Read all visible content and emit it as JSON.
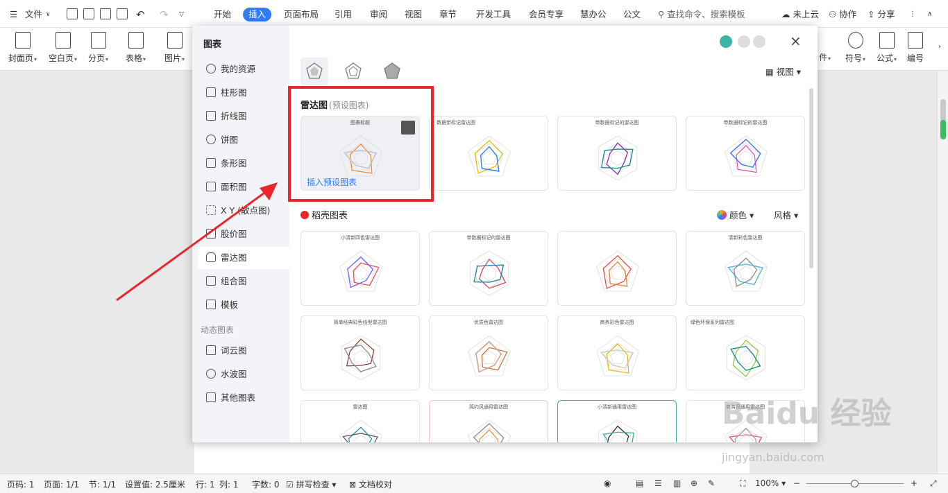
{
  "titlebar": {
    "menu_label": "文件",
    "tabs": [
      "开始",
      "插入",
      "页面布局",
      "引用",
      "审阅",
      "视图",
      "章节",
      "开发工具",
      "会员专享",
      "慧办公",
      "公文"
    ],
    "active_tab": "插入",
    "search_placeholder": "查找命令、搜索模板",
    "cloud": "未上云",
    "collab": "协作",
    "share": "分享"
  },
  "ribbon": {
    "left": [
      "封面页",
      "空白页",
      "分页",
      "表格",
      "图片"
    ],
    "right": [
      "符号",
      "公式",
      "编号"
    ],
    "partial": "件"
  },
  "dialog": {
    "sidebar_title": "图表",
    "sidebar_items": [
      "我的资源",
      "柱形图",
      "折线图",
      "饼图",
      "条形图",
      "面积图",
      "X Y (散点图)",
      "股价图",
      "雷达图",
      "组合图",
      "模板"
    ],
    "active_item": "雷达图",
    "dynamic_group": "动态图表",
    "dynamic_items": [
      "词云图",
      "水波图",
      "其他图表"
    ],
    "view_label": "视图",
    "section_preset": "雷达图",
    "section_preset_sub": "(预设图表)",
    "preset_cards": [
      {
        "title": "图表标题",
        "insert": "插入预设图表"
      },
      {
        "title": "数据带标记雷达图"
      },
      {
        "title": "带数据标记的雷达图"
      },
      {
        "title": "带数据标记的雷达图"
      }
    ],
    "section_daoke": "稻壳图表",
    "color_label": "颜色",
    "style_label": "风格",
    "daoke_cards": [
      "小清新四色雷达图",
      "带数据标记的雷达图",
      "",
      "清新彩色雷达图",
      "简单经典彩色线型雷达图",
      "优质色雷达图",
      "商务彩色雷达图",
      "绿色环保系列雷达图",
      "雷达图",
      "简约风通用雷达图",
      "小清新通用雷达图",
      "商务风通用雷达图"
    ]
  },
  "statusbar": {
    "page_no": "页码: 1",
    "pages": "页面: 1/1",
    "section": "节: 1/1",
    "setting": "设置值: 2.5厘米",
    "row": "行: 1",
    "col": "列: 1",
    "words": "字数: 0",
    "spell": "拼写检查",
    "proof": "文档校对",
    "zoom": "100%"
  },
  "watermark": {
    "logo": "Baidu 经验",
    "url": "jingyan.baidu.com"
  },
  "colors": {
    "accent": "#2f7cf6",
    "highlight": "#e8262b"
  }
}
